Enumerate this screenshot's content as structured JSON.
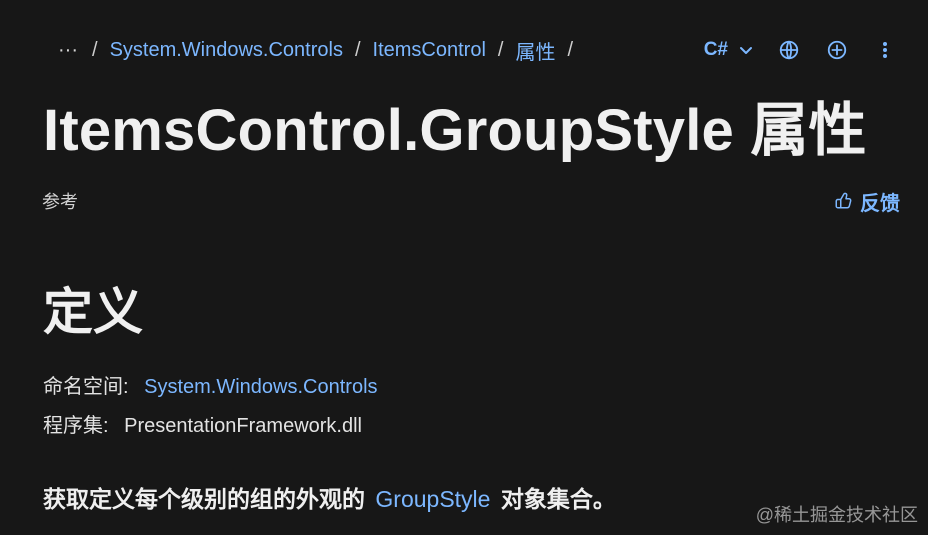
{
  "breadcrumb": {
    "more_label": "···",
    "items": [
      {
        "label": "System.Windows.Controls"
      },
      {
        "label": "ItemsControl"
      },
      {
        "label": "属性"
      }
    ]
  },
  "toolbar": {
    "language_label": "C#"
  },
  "header": {
    "title": "ItemsControl.GroupStyle 属性"
  },
  "meta": {
    "left_label": "参考",
    "feedback_label": "反馈"
  },
  "definition": {
    "heading": "定义",
    "namespace_label": "命名空间:",
    "namespace_value": "System.Windows.Controls",
    "assembly_label": "程序集:",
    "assembly_value": "PresentationFramework.dll",
    "summary_before": "获取定义每个级别的组的外观的",
    "summary_link": "GroupStyle",
    "summary_after": "对象集合。"
  },
  "watermark": "@稀土掘金技术社区",
  "colors": {
    "background": "#171717",
    "accent": "#7cb7ff",
    "text": "#e6e6e6"
  },
  "icons": {
    "more": "ellipsis-icon",
    "language_caret": "chevron-down-icon",
    "globe": "globe-icon",
    "add": "plus-circle-icon",
    "kebab": "vertical-ellipsis-icon",
    "feedback": "thumb-up-icon"
  }
}
